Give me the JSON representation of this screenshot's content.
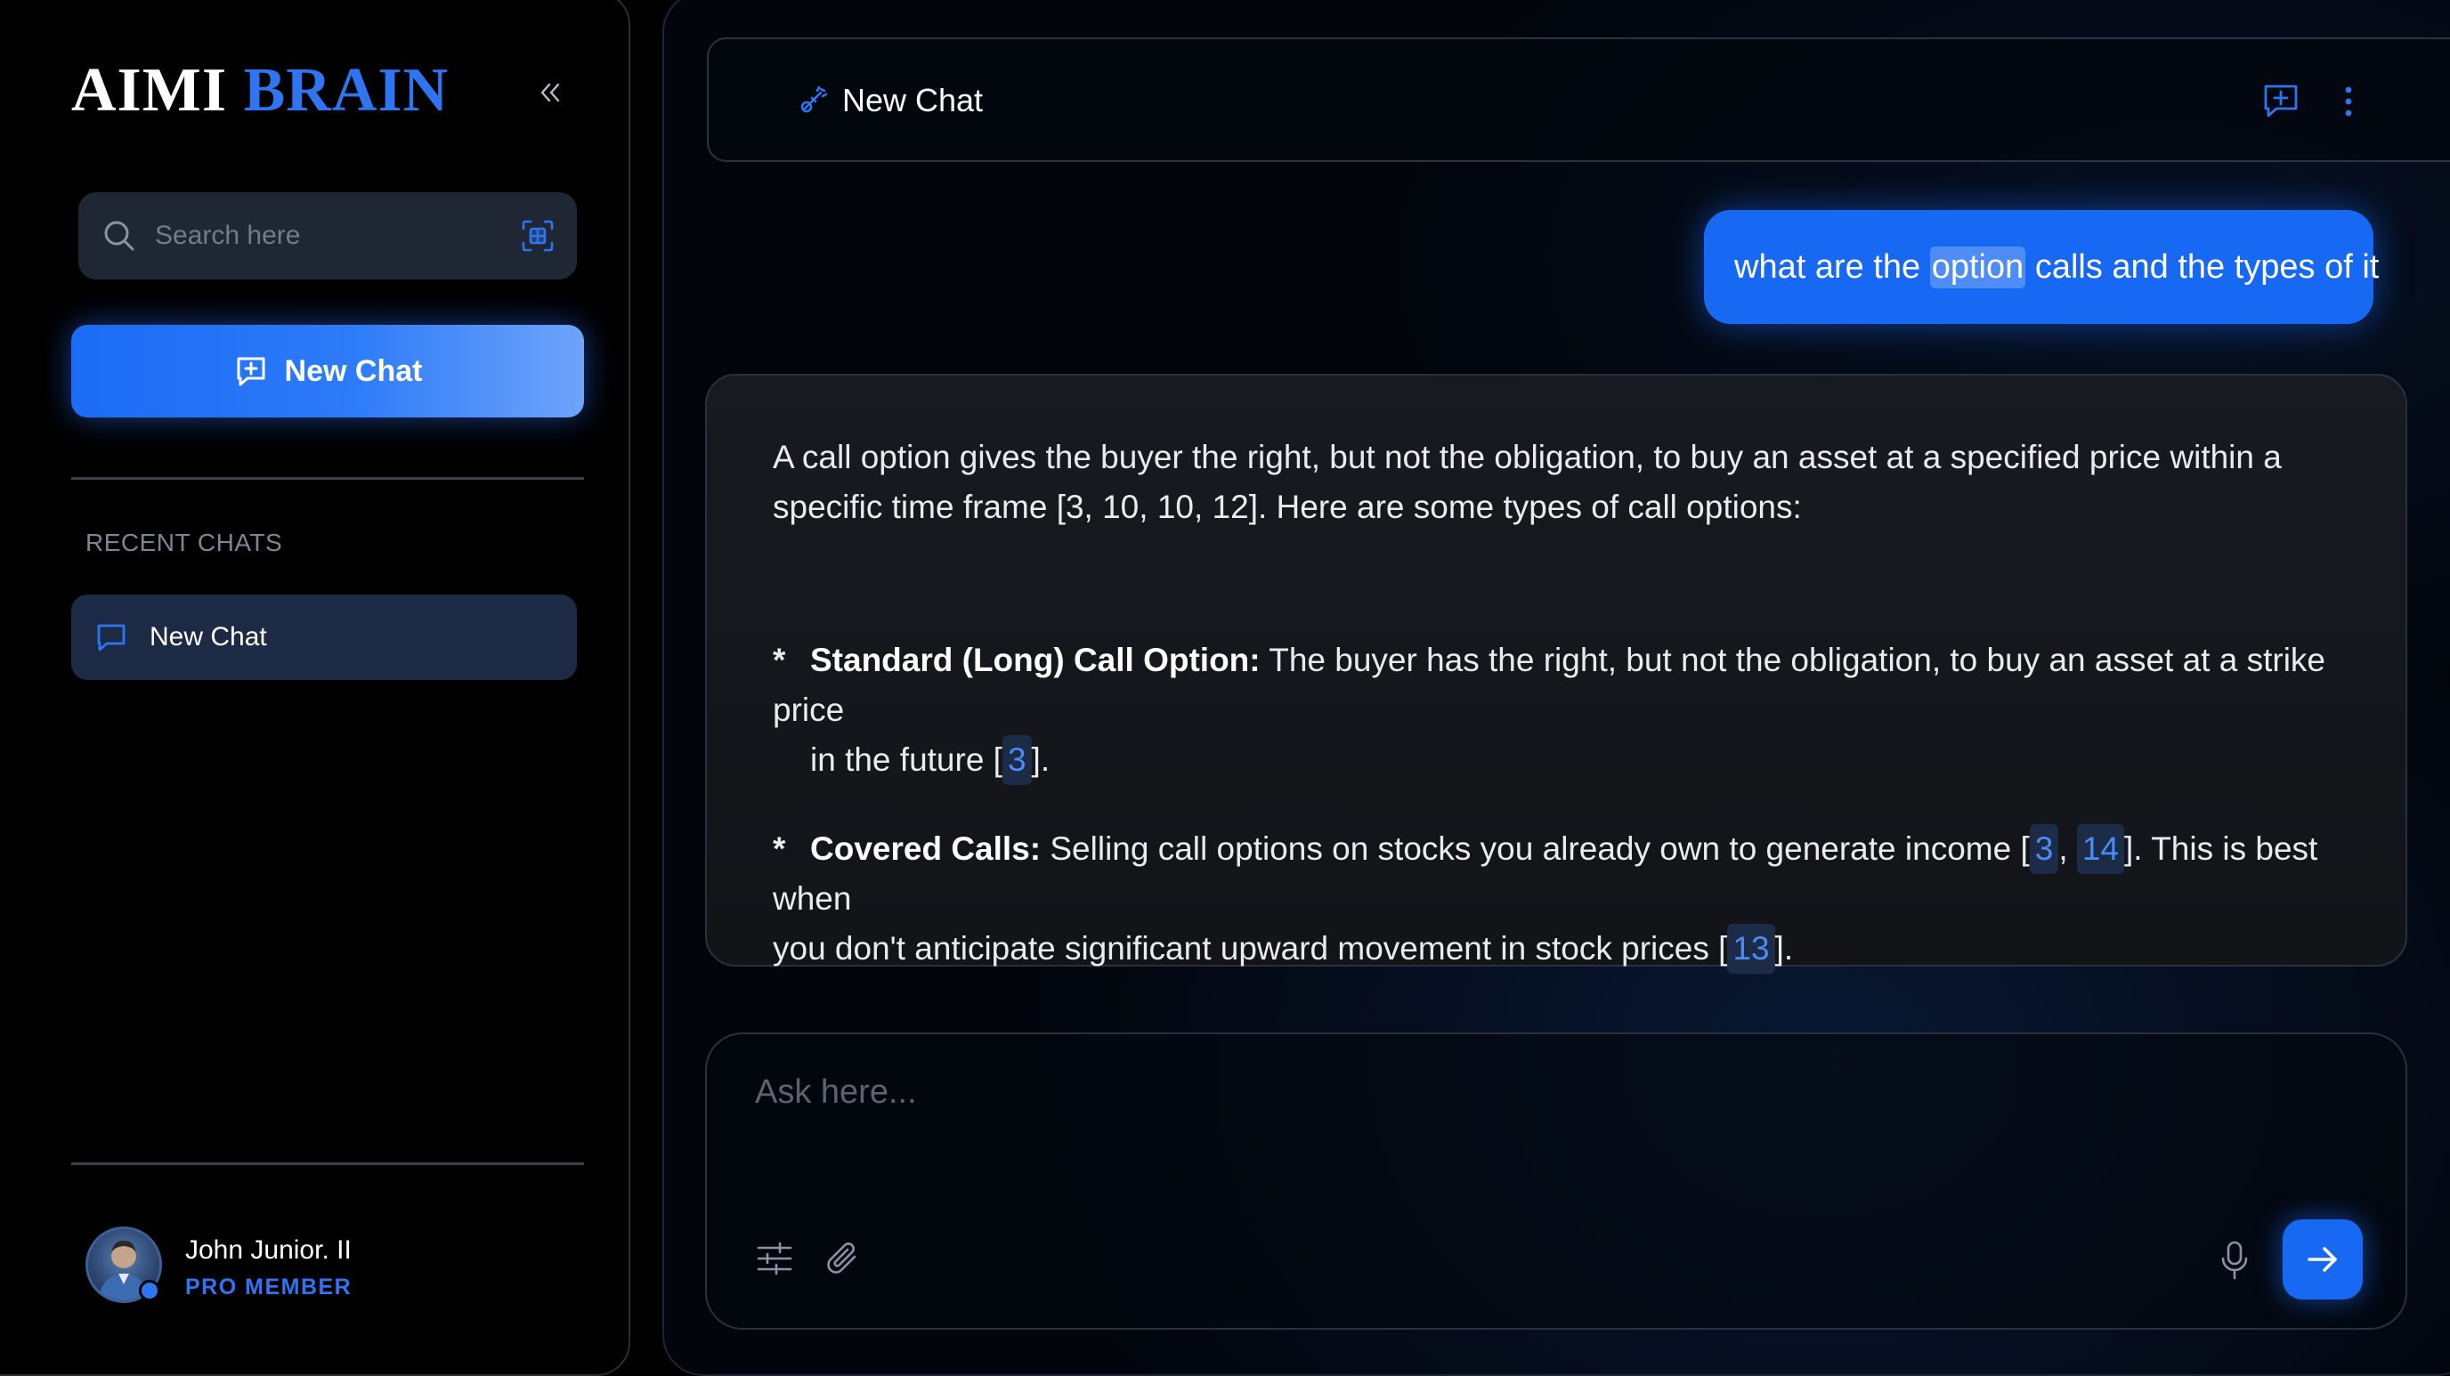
{
  "app": {
    "logo_part1": "AIMI",
    "logo_part2": "BRAIN"
  },
  "sidebar": {
    "search_placeholder": "Search here",
    "new_chat_label": "New Chat",
    "recent_label": "RECENT CHATS",
    "recent_chats": [
      {
        "label": "New Chat"
      }
    ]
  },
  "profile": {
    "name": "John Junior. II",
    "role": "PRO MEMBER"
  },
  "chat": {
    "title": "New Chat",
    "user_message": {
      "before": "what are the",
      "highlight": "option",
      "after": "calls and the types of it"
    },
    "ai_message": {
      "intro": "A call option gives the buyer the right, but not the obligation, to buy an asset at a specified price within a specific time frame [3, 10, 10, 12]. Here are some types of call options:",
      "items": [
        {
          "bullet": "*",
          "title": "Standard (Long) Call Option:",
          "text": " The buyer has the right, but not the obligation, to buy an asset at a strike price",
          "text2": "in the future [",
          "cites": [
            "3"
          ],
          "text3": "]."
        },
        {
          "bullet": "*",
          "title": "Covered Calls:",
          "text": " Selling call options on stocks you already own to generate income [",
          "cites": [
            "3",
            "14"
          ],
          "sep": ", ",
          "text_mid": "]. This is best when",
          "text2": "you don't anticipate significant upward movement in stock prices [",
          "cites2": [
            "13"
          ],
          "text3": "]."
        }
      ]
    },
    "composer_placeholder": "Ask here..."
  },
  "colors": {
    "accent": "#1769f3",
    "logo_accent": "#2f74f0",
    "citation": "#4a8bf5"
  },
  "icons": {
    "collapse": "double-chevron-left-icon",
    "search": "search-icon",
    "scan": "scan-icon",
    "new_chat": "add-chat-icon",
    "chat": "chat-bubble-icon",
    "title": "sparkle-icon",
    "new_chat_top": "add-chat-icon",
    "more": "more-vertical-icon",
    "settings": "sliders-icon",
    "attach": "paperclip-icon",
    "mic": "microphone-icon",
    "send": "arrow-right-icon"
  }
}
